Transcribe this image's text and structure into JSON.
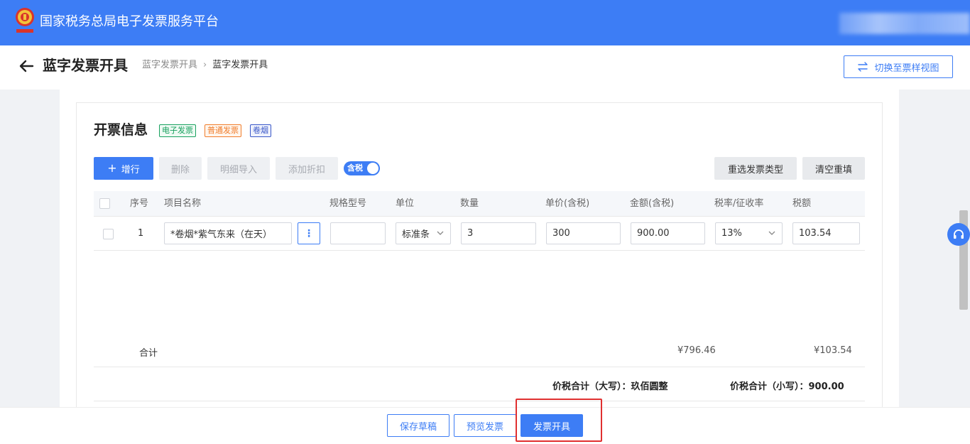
{
  "app": {
    "title": "国家税务总局电子发票服务平台"
  },
  "header": {
    "page_title": "蓝字发票开具",
    "breadcrumb": [
      "蓝字发票开具",
      "蓝字发票开具"
    ],
    "switch_view_label": "切换至票样视图"
  },
  "section": {
    "title": "开票信息",
    "tags": [
      "电子发票",
      "普通发票",
      "卷烟"
    ]
  },
  "toolbar": {
    "add_row": "增行",
    "delete": "删除",
    "import_detail": "明细导入",
    "add_discount": "添加折扣",
    "tax_included_toggle": "含税",
    "reselect_type": "重选发票类型",
    "clear_refill": "清空重填"
  },
  "table": {
    "columns": [
      "序号",
      "项目名称",
      "规格型号",
      "单位",
      "数量",
      "单价(含税)",
      "金额(含税)",
      "税率/征收率",
      "税额"
    ],
    "rows": [
      {
        "index": "1",
        "item_name": "*卷烟*紫气东来（在天）",
        "spec": "",
        "unit": "标准条",
        "quantity": "3",
        "unit_price": "300",
        "amount": "900.00",
        "tax_rate": "13%",
        "tax": "103.54"
      }
    ],
    "totals": {
      "label": "合计",
      "amount": "¥796.46",
      "tax": "¥103.54"
    },
    "sum_upper_label": "价税合计（大写）：",
    "sum_upper_value": "玖佰圆整",
    "sum_lower_label": "价税合计（小写）：",
    "sum_lower_value": "900.00"
  },
  "footer": {
    "save_draft": "保存草稿",
    "preview": "预览发票",
    "issue": "发票开具"
  },
  "colors": {
    "primary": "#3d7df5",
    "highlight": "#e03030"
  }
}
